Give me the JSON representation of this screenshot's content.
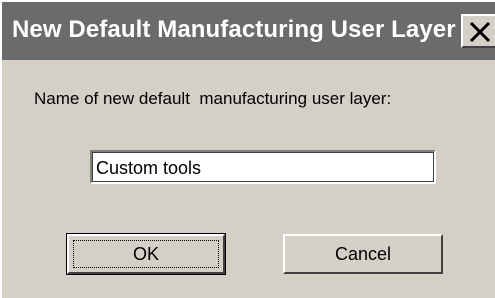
{
  "dialog": {
    "title": "New Default Manufacturing User Layer",
    "close_icon": "close-icon",
    "prompt": "Name of new default  manufacturing user layer:",
    "name_value": "Custom tools",
    "ok_label": "OK",
    "cancel_label": "Cancel"
  },
  "colors": {
    "titlebar": "#6b6b6b",
    "face": "#d4d0c8",
    "field": "#ffffff"
  }
}
